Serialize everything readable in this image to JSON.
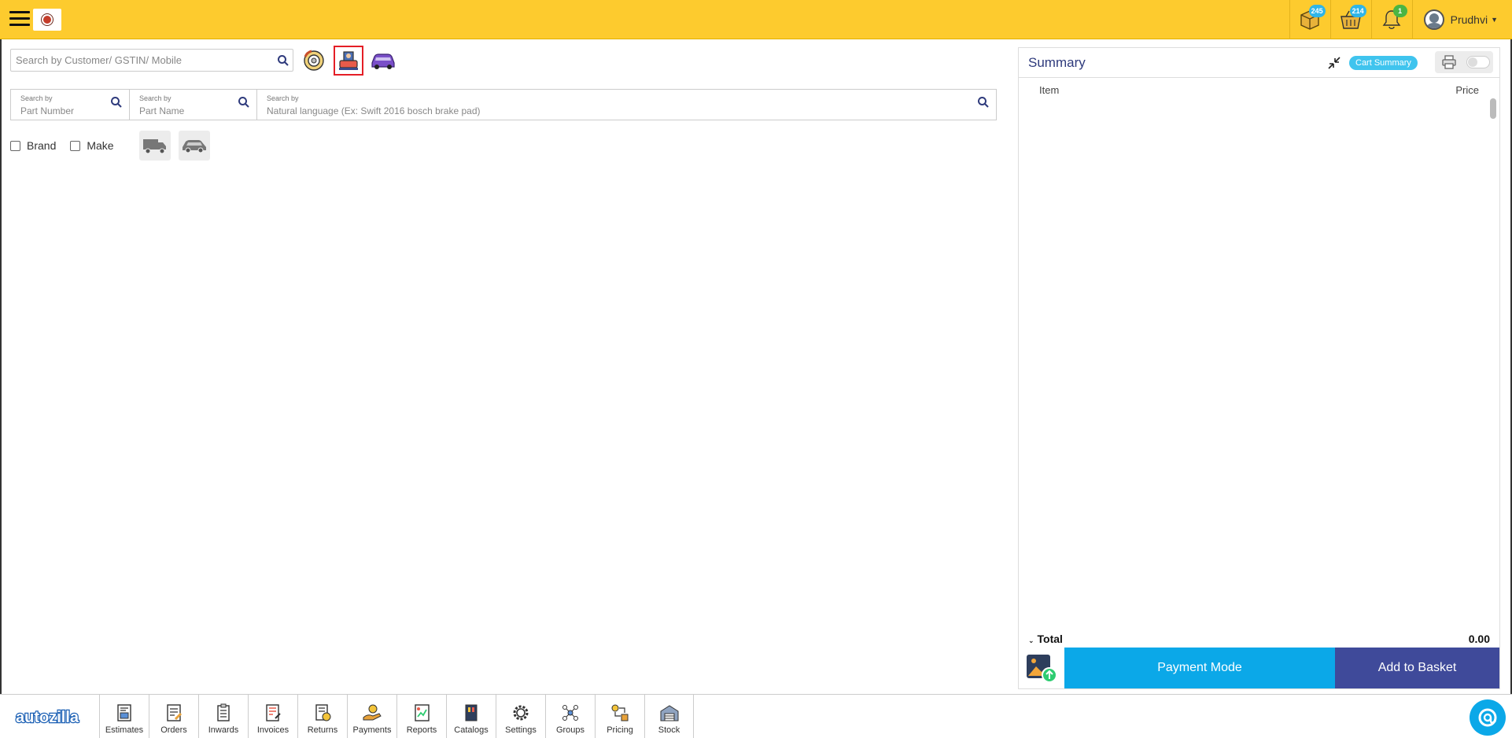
{
  "header": {
    "icons": {
      "packages_count": "245",
      "basket_count": "214",
      "notifications_count": "1"
    },
    "user_name": "Prudhvi"
  },
  "search": {
    "customer_placeholder": "Search by Customer/ GSTIN/ Mobile",
    "part_number_label": "Search by",
    "part_number_placeholder": "Part Number",
    "part_name_label": "Search by",
    "part_name_placeholder": "Part Name",
    "natural_label": "Search by",
    "natural_placeholder": "Natural language (Ex: Swift 2016 bosch brake pad)"
  },
  "filters": {
    "brand": "Brand",
    "make": "Make"
  },
  "summary": {
    "title": "Summary",
    "cart_summary_label": "Cart Summary",
    "col_item": "Item",
    "col_price": "Price",
    "total_label": "Total",
    "total_value": "0.00",
    "payment_mode_label": "Payment Mode",
    "add_to_basket_label": "Add to Basket"
  },
  "nav": {
    "items": [
      {
        "label": "Estimates"
      },
      {
        "label": "Orders"
      },
      {
        "label": "Inwards"
      },
      {
        "label": "Invoices"
      },
      {
        "label": "Returns"
      },
      {
        "label": "Payments"
      },
      {
        "label": "Reports"
      },
      {
        "label": "Catalogs"
      },
      {
        "label": "Settings"
      },
      {
        "label": "Groups"
      },
      {
        "label": "Pricing"
      },
      {
        "label": "Stock"
      }
    ]
  },
  "colors": {
    "header_bg": "#fdcb2e",
    "primary_blue": "#0ba8e8",
    "indigo": "#3f4a9a",
    "selected_border": "#e41e26"
  }
}
